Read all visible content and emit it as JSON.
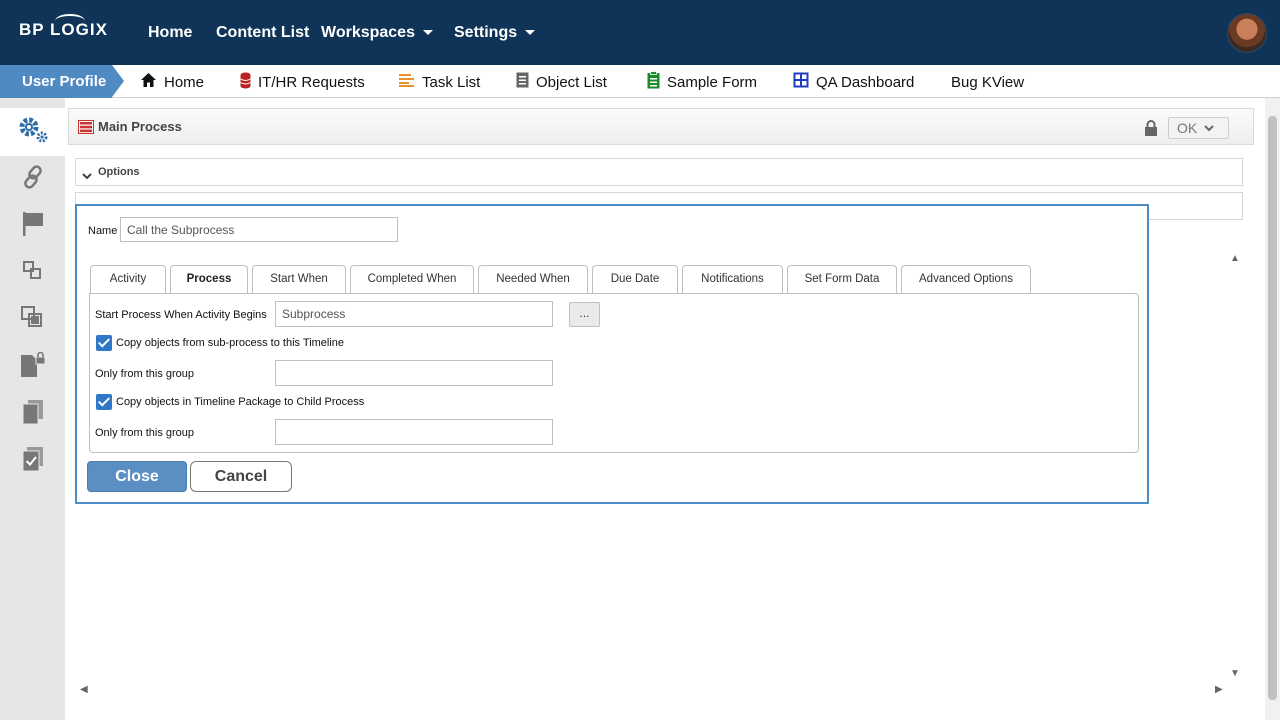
{
  "topbar": {
    "logo": "BP LOGIX",
    "nav": {
      "home": "Home",
      "content_list": "Content List",
      "workspaces": "Workspaces",
      "settings": "Settings"
    }
  },
  "bookmarks": {
    "user_profile": "User Profile",
    "items": [
      "Home",
      "IT/HR Requests",
      "Task List",
      "Object List",
      "Sample Form",
      "QA Dashboard",
      "Bug KView"
    ]
  },
  "sidebar": {
    "icons": [
      "gears-icon",
      "link-icon",
      "flag-icon",
      "subprocess-icon",
      "copy-icon",
      "locked-document-icon",
      "documents-icon",
      "checklist-icon"
    ]
  },
  "panel": {
    "title": "Main Process",
    "ok_label": "OK",
    "options_label": "Options"
  },
  "dialog": {
    "name_label": "Name",
    "name_value": "Call the Subprocess",
    "tabs": [
      "Activity",
      "Process",
      "Start When",
      "Completed When",
      "Needed When",
      "Due Date",
      "Notifications",
      "Set Form Data",
      "Advanced Options"
    ],
    "active_tab": "Process",
    "start_process_label": "Start Process When Activity Begins",
    "start_process_value": "Subprocess",
    "browse_label": "...",
    "copy_from_sub_label": "Copy objects from sub-process to this Timeline",
    "copy_from_sub_checked": true,
    "only_group_label_1": "Only from this group",
    "only_group_value_1": "",
    "copy_package_label": "Copy objects in Timeline Package to Child Process",
    "copy_package_checked": true,
    "only_group_label_2": "Only from this group",
    "only_group_value_2": "",
    "close_label": "Close",
    "cancel_label": "Cancel"
  },
  "colors": {
    "topbar": "#0f3458",
    "accent": "#4f8ac3",
    "checkbox": "#2f77c7",
    "dialog_border": "#4a8cc4"
  }
}
